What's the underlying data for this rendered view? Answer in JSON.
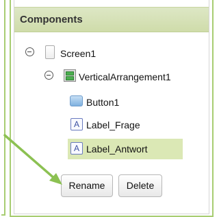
{
  "panel": {
    "title": "Components"
  },
  "tree": {
    "screen": "Screen1",
    "arrangement": "VerticalArrangement1",
    "button": "Button1",
    "label_frage": "Label_Frage",
    "label_antwort": "Label_Antwort",
    "label_icon_glyph": "A"
  },
  "actions": {
    "rename": "Rename",
    "delete": "Delete"
  },
  "colors": {
    "accent_green": "#a7cd71",
    "selected_row": "#dbe8b5"
  },
  "icons": [
    "collapse-toggle-icon",
    "screen-icon",
    "vertical-arrangement-icon",
    "button-icon",
    "label-icon",
    "pointer-arrow-icon"
  ]
}
